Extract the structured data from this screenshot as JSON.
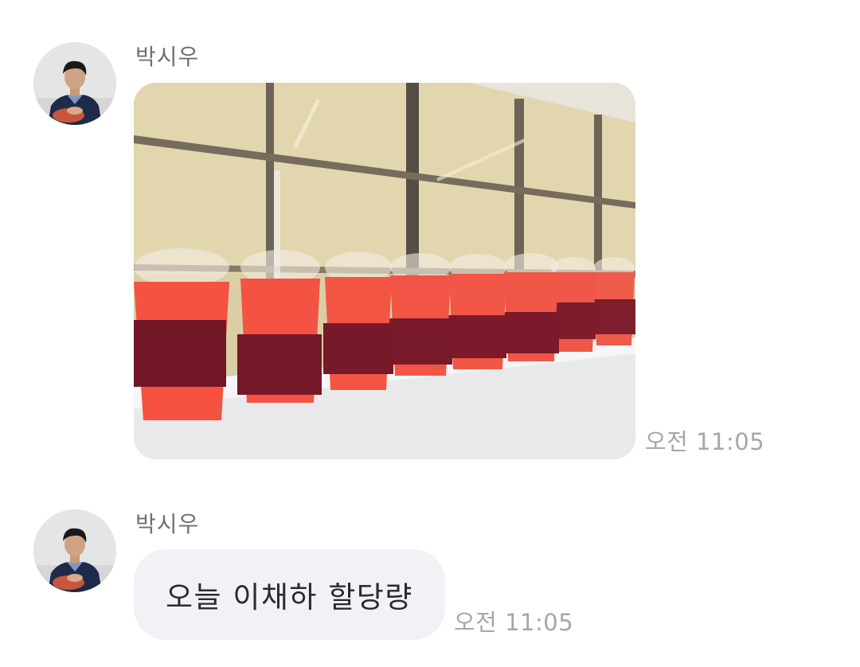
{
  "messages": [
    {
      "sender": "박시우",
      "type": "image",
      "image_icon": "photo-icon",
      "time": "오전 11:05"
    },
    {
      "sender": "박시우",
      "type": "text",
      "text": "오늘 이채하 할당량",
      "time": "오전 11:05"
    }
  ],
  "colors": {
    "sender_name": "#6f6f74",
    "time": "#a6a6ab",
    "bubble_bg": "#f1f2f5",
    "bubble_text": "#2b2b2e"
  }
}
